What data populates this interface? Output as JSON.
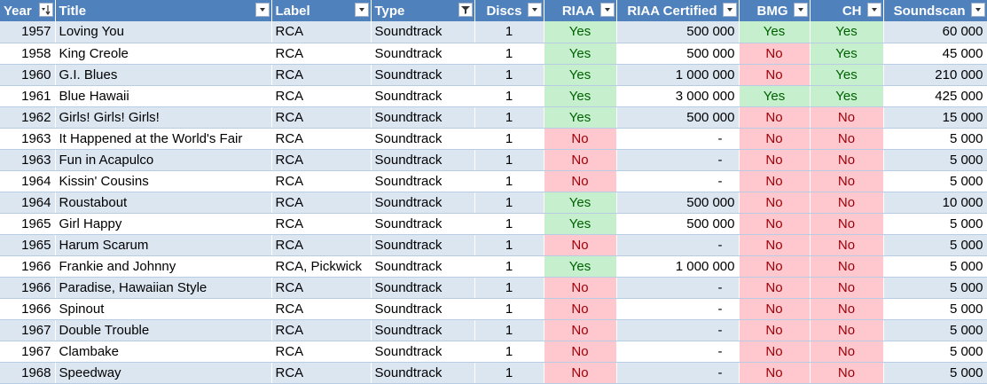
{
  "headers": {
    "year": "Year",
    "title": "Title",
    "label": "Label",
    "type": "Type",
    "discs": "Discs",
    "riaa": "RIAA",
    "riaa_certified": "RIAA Certified",
    "bmg": "BMG",
    "ch": "CH",
    "soundscan": "Soundscan"
  },
  "filter_icons": {
    "year": "sort-ascending-icon",
    "type": "filter-applied-icon",
    "default": "dropdown-arrow-icon"
  },
  "colors": {
    "header_bg": "#4f81bd",
    "band_row": "#dce6f1",
    "yes_bg": "#c6efce",
    "yes_text": "#006100",
    "no_bg": "#ffc7ce",
    "no_text": "#9c0006"
  },
  "rows": [
    {
      "year": "1957",
      "title": "Loving You",
      "label": "RCA",
      "type": "Soundtrack",
      "discs": "1",
      "riaa": "Yes",
      "riaa_certified": "500 000",
      "bmg": "Yes",
      "ch": "Yes",
      "soundscan": "60 000"
    },
    {
      "year": "1958",
      "title": "King Creole",
      "label": "RCA",
      "type": "Soundtrack",
      "discs": "1",
      "riaa": "Yes",
      "riaa_certified": "500 000",
      "bmg": "No",
      "ch": "Yes",
      "soundscan": "45 000"
    },
    {
      "year": "1960",
      "title": "G.I. Blues",
      "label": "RCA",
      "type": "Soundtrack",
      "discs": "1",
      "riaa": "Yes",
      "riaa_certified": "1 000 000",
      "bmg": "No",
      "ch": "Yes",
      "soundscan": "210 000"
    },
    {
      "year": "1961",
      "title": "Blue Hawaii",
      "label": "RCA",
      "type": "Soundtrack",
      "discs": "1",
      "riaa": "Yes",
      "riaa_certified": "3 000 000",
      "bmg": "Yes",
      "ch": "Yes",
      "soundscan": "425 000"
    },
    {
      "year": "1962",
      "title": "Girls! Girls! Girls!",
      "label": "RCA",
      "type": "Soundtrack",
      "discs": "1",
      "riaa": "Yes",
      "riaa_certified": "500 000",
      "bmg": "No",
      "ch": "No",
      "soundscan": "15 000"
    },
    {
      "year": "1963",
      "title": "It Happened at the World's Fair",
      "label": "RCA",
      "type": "Soundtrack",
      "discs": "1",
      "riaa": "No",
      "riaa_certified": "-",
      "bmg": "No",
      "ch": "No",
      "soundscan": "5 000"
    },
    {
      "year": "1963",
      "title": "Fun in Acapulco",
      "label": "RCA",
      "type": "Soundtrack",
      "discs": "1",
      "riaa": "No",
      "riaa_certified": "-",
      "bmg": "No",
      "ch": "No",
      "soundscan": "5 000"
    },
    {
      "year": "1964",
      "title": "Kissin' Cousins",
      "label": "RCA",
      "type": "Soundtrack",
      "discs": "1",
      "riaa": "No",
      "riaa_certified": "-",
      "bmg": "No",
      "ch": "No",
      "soundscan": "5 000"
    },
    {
      "year": "1964",
      "title": "Roustabout",
      "label": "RCA",
      "type": "Soundtrack",
      "discs": "1",
      "riaa": "Yes",
      "riaa_certified": "500 000",
      "bmg": "No",
      "ch": "No",
      "soundscan": "10 000"
    },
    {
      "year": "1965",
      "title": "Girl Happy",
      "label": "RCA",
      "type": "Soundtrack",
      "discs": "1",
      "riaa": "Yes",
      "riaa_certified": "500 000",
      "bmg": "No",
      "ch": "No",
      "soundscan": "5 000"
    },
    {
      "year": "1965",
      "title": "Harum Scarum",
      "label": "RCA",
      "type": "Soundtrack",
      "discs": "1",
      "riaa": "No",
      "riaa_certified": "-",
      "bmg": "No",
      "ch": "No",
      "soundscan": "5 000"
    },
    {
      "year": "1966",
      "title": "Frankie and Johnny",
      "label": "RCA, Pickwick",
      "type": "Soundtrack",
      "discs": "1",
      "riaa": "Yes",
      "riaa_certified": "1 000 000",
      "bmg": "No",
      "ch": "No",
      "soundscan": "5 000"
    },
    {
      "year": "1966",
      "title": "Paradise, Hawaiian Style",
      "label": "RCA",
      "type": "Soundtrack",
      "discs": "1",
      "riaa": "No",
      "riaa_certified": "-",
      "bmg": "No",
      "ch": "No",
      "soundscan": "5 000"
    },
    {
      "year": "1966",
      "title": "Spinout",
      "label": "RCA",
      "type": "Soundtrack",
      "discs": "1",
      "riaa": "No",
      "riaa_certified": "-",
      "bmg": "No",
      "ch": "No",
      "soundscan": "5 000"
    },
    {
      "year": "1967",
      "title": "Double Trouble",
      "label": "RCA",
      "type": "Soundtrack",
      "discs": "1",
      "riaa": "No",
      "riaa_certified": "-",
      "bmg": "No",
      "ch": "No",
      "soundscan": "5 000"
    },
    {
      "year": "1967",
      "title": "Clambake",
      "label": "RCA",
      "type": "Soundtrack",
      "discs": "1",
      "riaa": "No",
      "riaa_certified": "-",
      "bmg": "No",
      "ch": "No",
      "soundscan": "5 000"
    },
    {
      "year": "1968",
      "title": "Speedway",
      "label": "RCA",
      "type": "Soundtrack",
      "discs": "1",
      "riaa": "No",
      "riaa_certified": "-",
      "bmg": "No",
      "ch": "No",
      "soundscan": "5 000"
    }
  ]
}
